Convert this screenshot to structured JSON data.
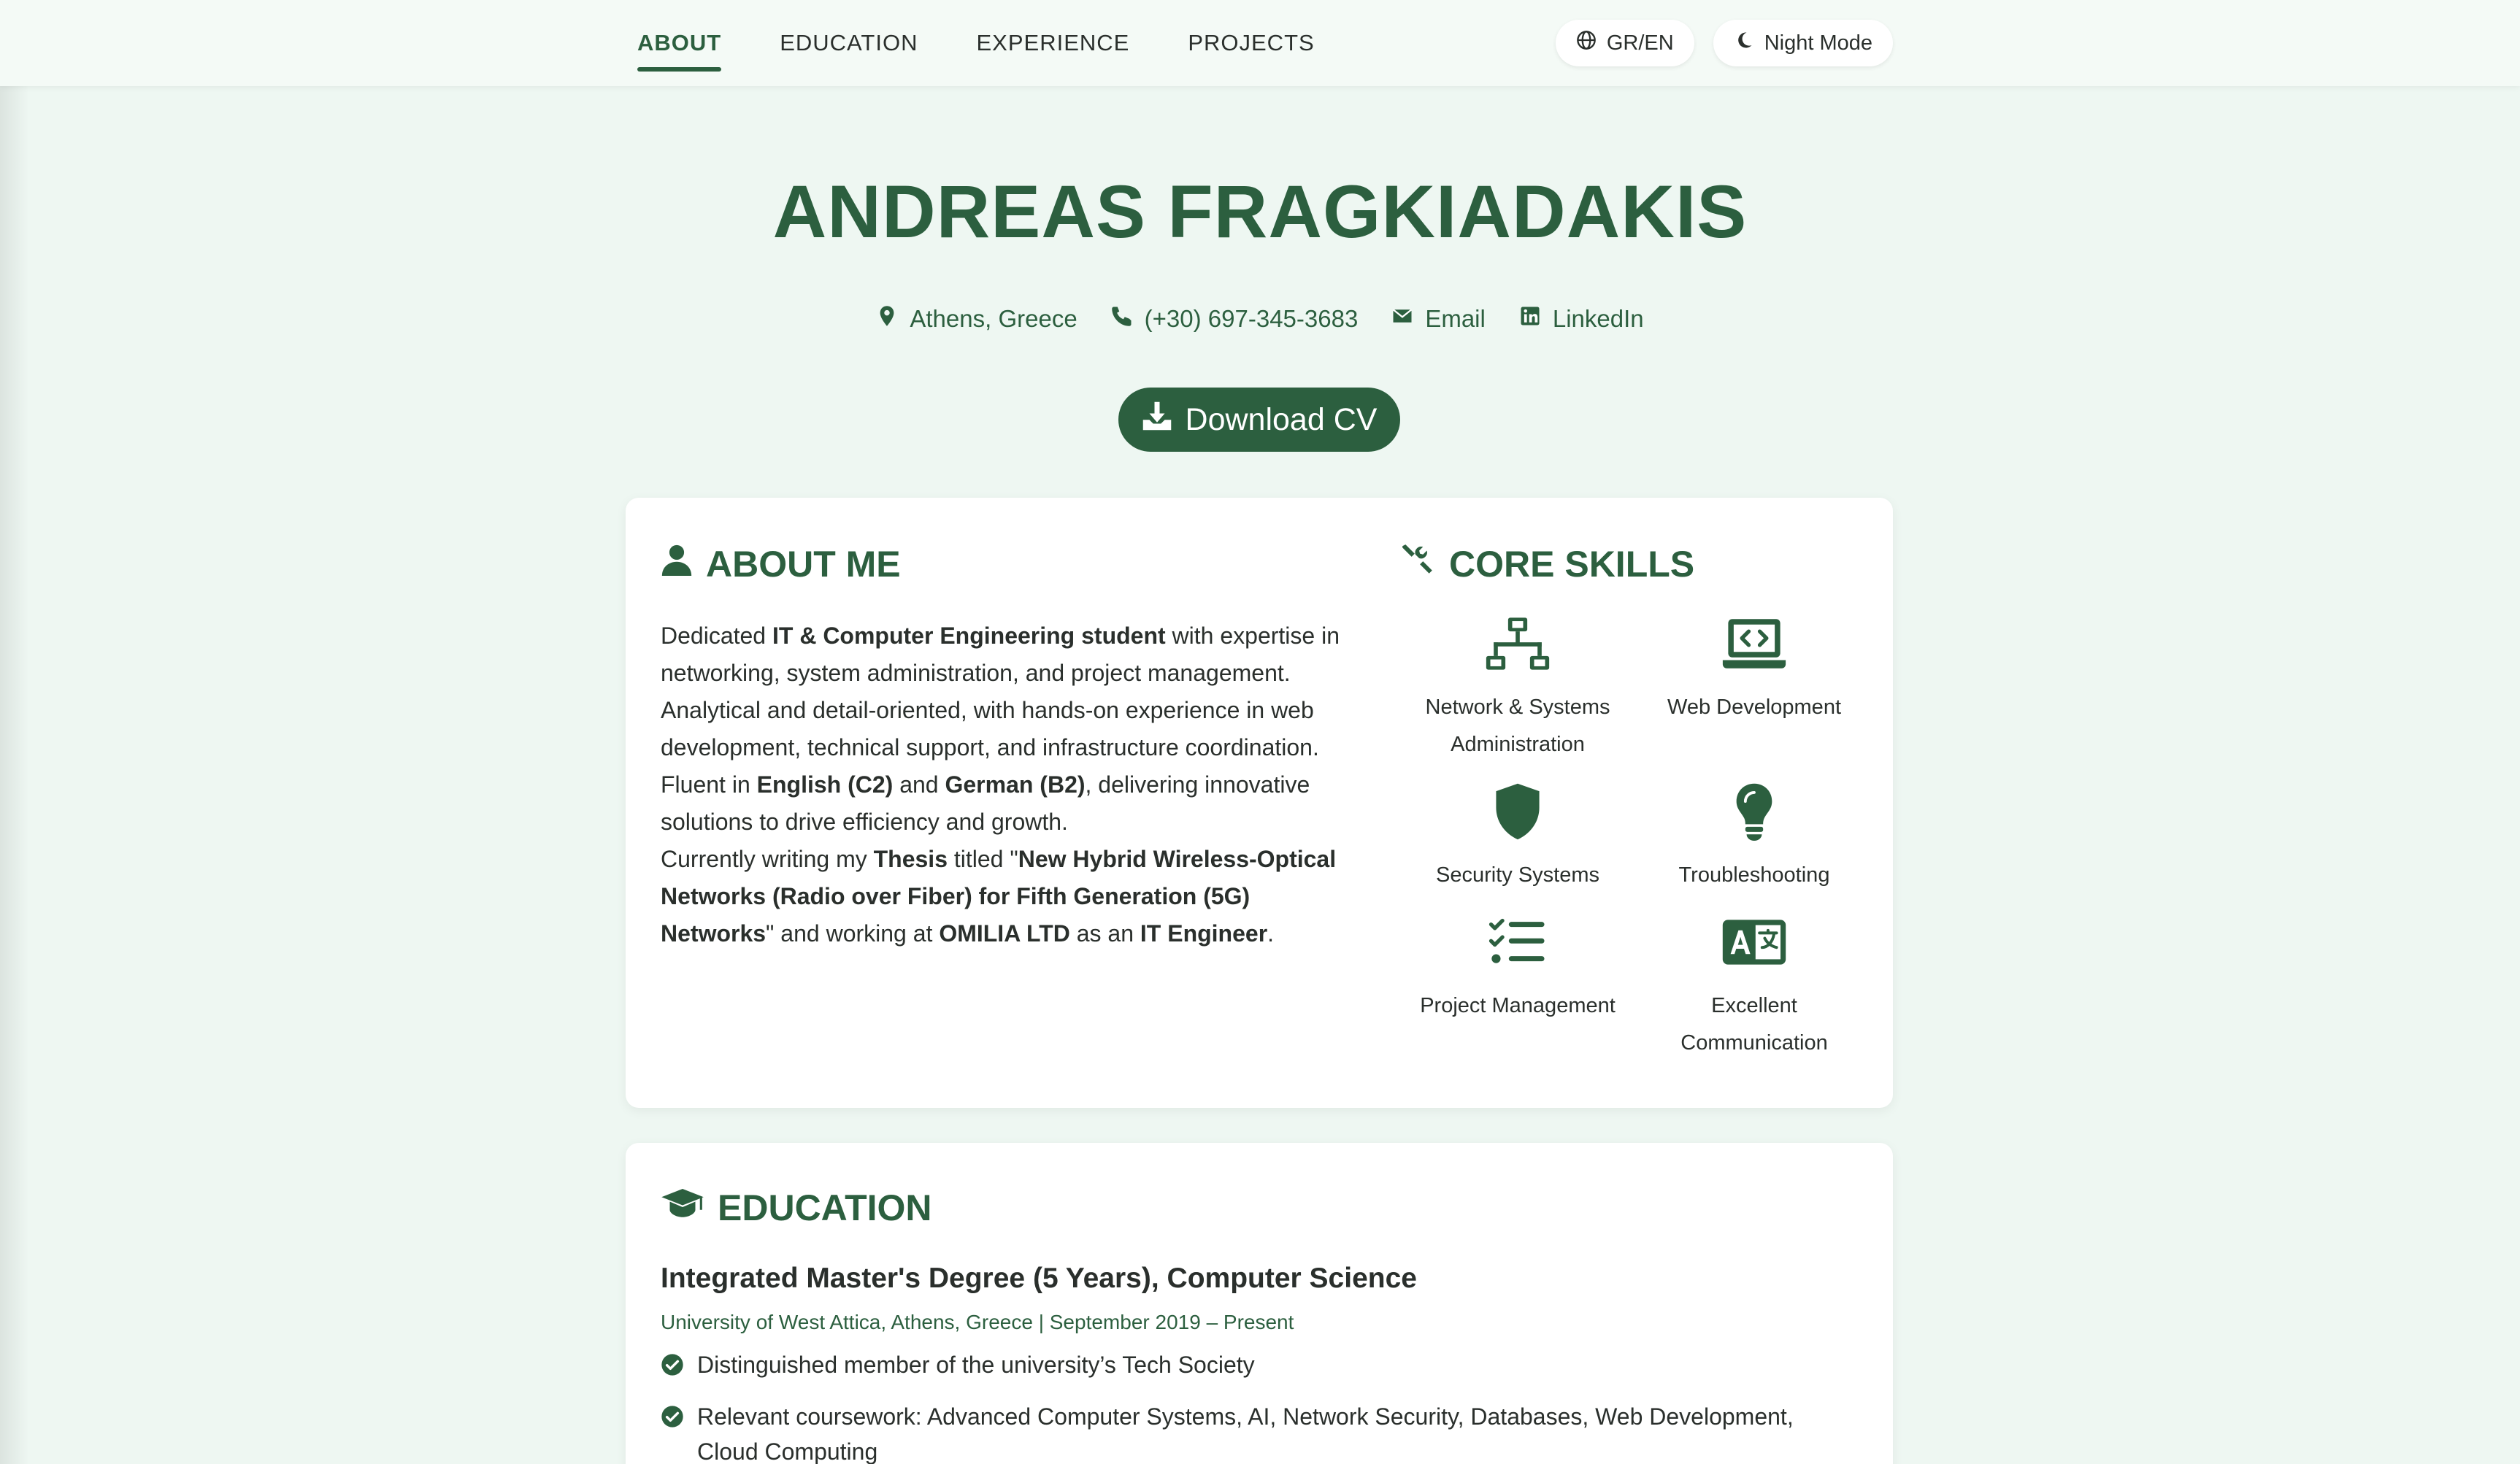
{
  "nav": {
    "links": [
      "ABOUT",
      "EDUCATION",
      "EXPERIENCE",
      "PROJECTS"
    ],
    "lang_label": "GR/EN",
    "night_label": "Night Mode"
  },
  "hero": {
    "name": "ANDREAS FRAGKIADAKIS",
    "location": "Athens, Greece",
    "phone": "(+30) 697-345-3683",
    "email": "Email",
    "linkedin": "LinkedIn",
    "download": "Download CV"
  },
  "about": {
    "title": "ABOUT ME",
    "p1_a": "Dedicated ",
    "p1_b": "IT & Computer Engineering student",
    "p1_c": " with expertise in networking, system administration, and project management. Analytical and detail-oriented, with hands-on experience in web development, technical support, and infrastructure coordination. Fluent in ",
    "p1_d": "English (C2)",
    "p1_e": " and ",
    "p1_f": "German (B2)",
    "p1_g": ", delivering innovative solutions to drive efficiency and growth.",
    "p2_a": "Currently writing my ",
    "p2_b": "Thesis",
    "p2_c": " titled \"",
    "p2_d": "New Hybrid Wireless-Optical Networks (Radio over Fiber) for Fifth Generation (5G) Networks",
    "p2_e": "\" and working at ",
    "p2_f": "OMILIA LTD",
    "p2_g": " as an ",
    "p2_h": "IT Engineer",
    "p2_i": "."
  },
  "skills": {
    "title": "CORE SKILLS",
    "items": [
      {
        "label": "Network & Systems Administration",
        "icon": "network-icon"
      },
      {
        "label": "Web Development",
        "icon": "laptop-code-icon"
      },
      {
        "label": "Security Systems",
        "icon": "shield-icon"
      },
      {
        "label": "Troubleshooting",
        "icon": "lightbulb-icon"
      },
      {
        "label": "Project Management",
        "icon": "list-check-icon"
      },
      {
        "label": "Excellent Communication",
        "icon": "language-icon"
      }
    ]
  },
  "education": {
    "title": "EDUCATION",
    "degree": "Integrated Master's Degree (5 Years), Computer Science",
    "meta": "University of West Attica, Athens, Greece | September 2019 – Present",
    "bullets": [
      "Distinguished member of the university’s Tech Society",
      "Relevant coursework: Advanced Computer Systems, AI, Network Security, Databases, Web Development, Cloud Computing"
    ]
  },
  "colors": {
    "accent": "#2c5f3f",
    "background": "#eef7f2"
  }
}
